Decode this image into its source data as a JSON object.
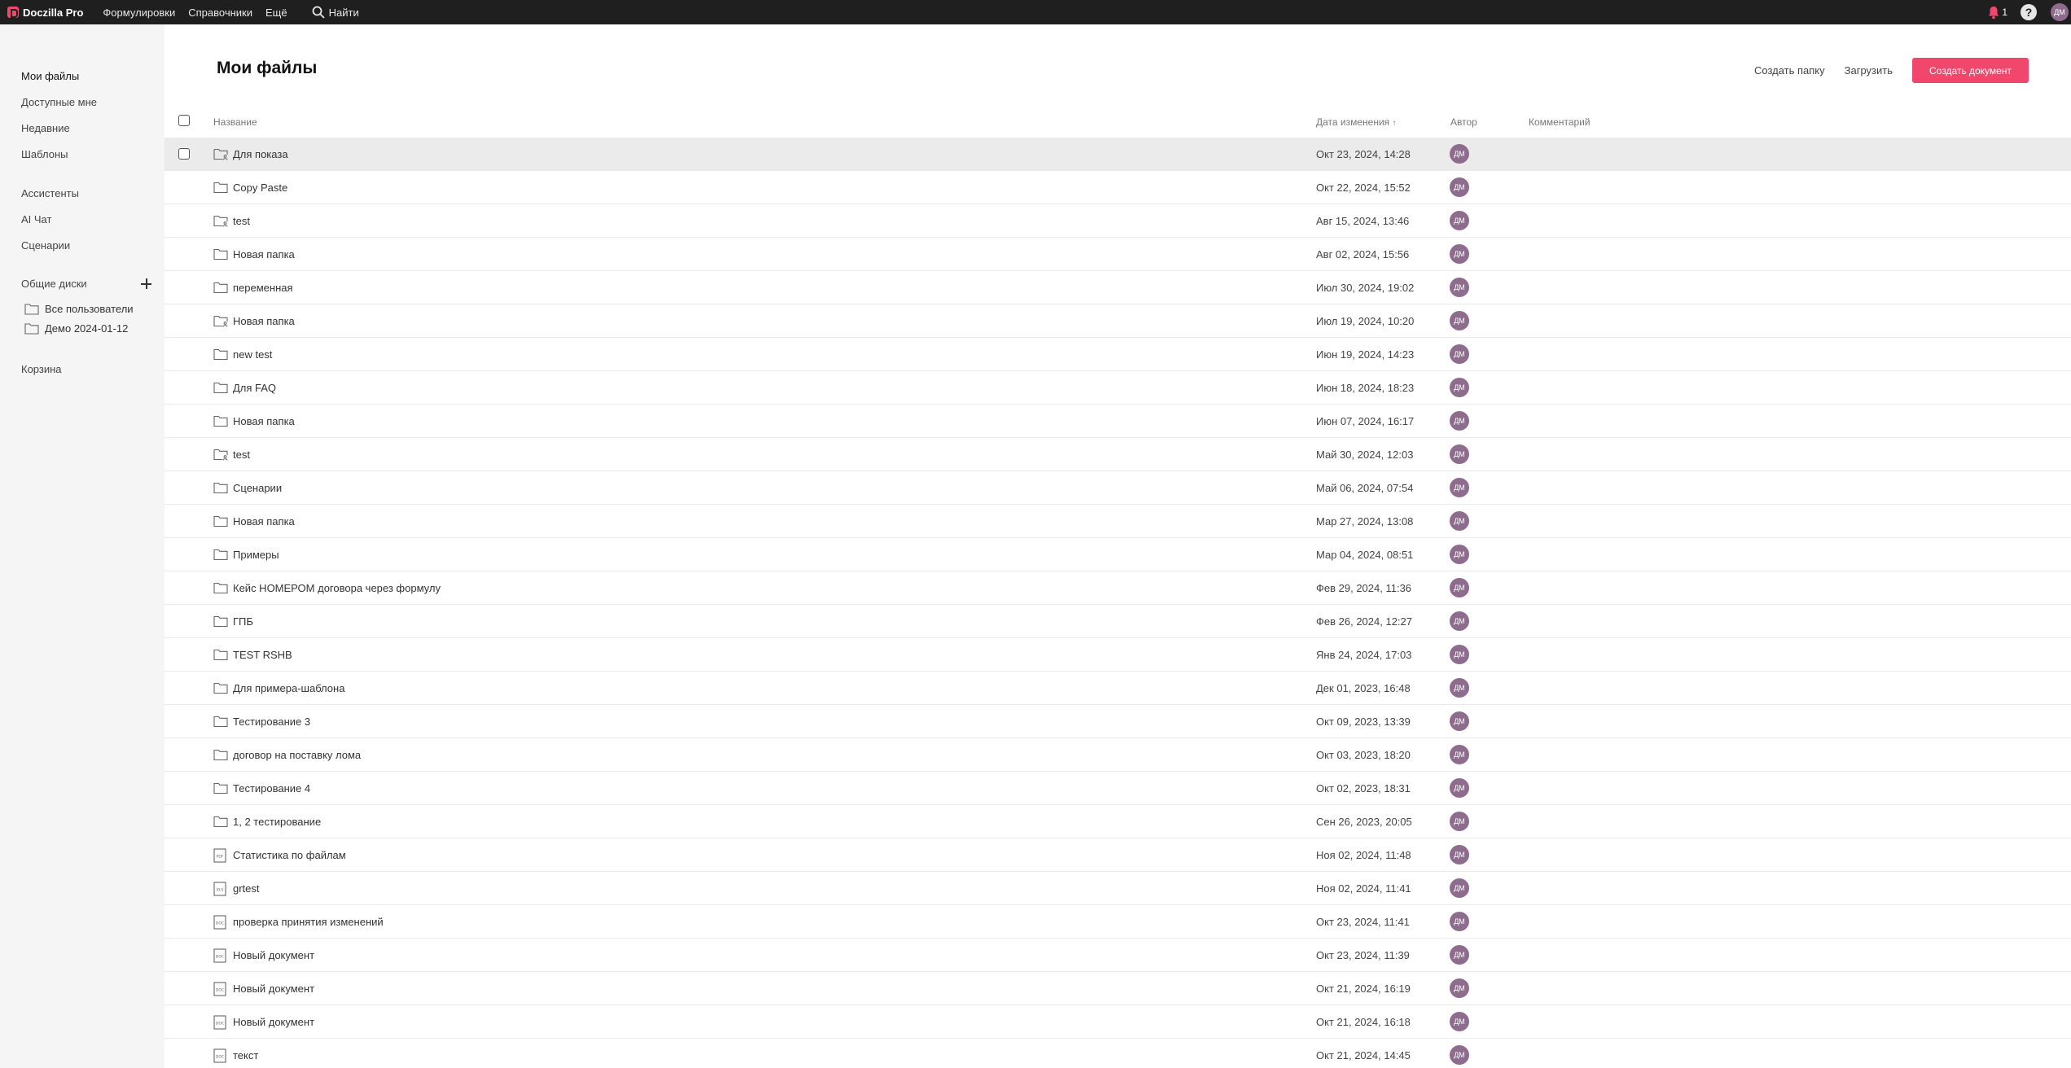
{
  "topbar": {
    "brand": "Doczilla Pro",
    "nav": [
      "Формулировки",
      "Справочники",
      "Ещё"
    ],
    "search_label": "Найти",
    "notifications_count": "1",
    "help_label": "?",
    "user_initials": "ДМ"
  },
  "sidebar": {
    "items": [
      {
        "label": "Мои файлы"
      },
      {
        "label": "Доступные мне"
      },
      {
        "label": "Недавние"
      },
      {
        "label": "Шаблоны"
      },
      {
        "label": "Ассистенты"
      },
      {
        "label": "AI Чат"
      },
      {
        "label": "Сценарии"
      }
    ],
    "shared_header": "Общие диски",
    "shared_disks": [
      {
        "label": "Все пользователи"
      },
      {
        "label": "Демо 2024-01-12"
      }
    ],
    "trash": "Корзина"
  },
  "main": {
    "title": "Мои файлы",
    "create_folder": "Создать папку",
    "upload": "Загрузить",
    "create_document": "Создать документ",
    "columns": {
      "name": "Название",
      "date": "Дата изменения",
      "author": "Автор",
      "comment": "Комментарий"
    },
    "rows": [
      {
        "icon": "shared-folder",
        "name": "Для показа",
        "date": "Окт 23, 2024, 14:28",
        "author": "ДМ"
      },
      {
        "icon": "folder",
        "name": "Copy Paste",
        "date": "Окт 22, 2024, 15:52",
        "author": "ДМ"
      },
      {
        "icon": "shared-folder",
        "name": "test",
        "date": "Авг 15, 2024, 13:46",
        "author": "ДМ"
      },
      {
        "icon": "folder",
        "name": "Новая папка",
        "date": "Авг 02, 2024, 15:56",
        "author": "ДМ"
      },
      {
        "icon": "folder",
        "name": "переменная",
        "date": "Июл 30, 2024, 19:02",
        "author": "ДМ"
      },
      {
        "icon": "shared-folder",
        "name": "Новая папка",
        "date": "Июл 19, 2024, 10:20",
        "author": "ДМ"
      },
      {
        "icon": "folder",
        "name": "new test",
        "date": "Июн 19, 2024, 14:23",
        "author": "ДМ"
      },
      {
        "icon": "folder",
        "name": "Для FAQ",
        "date": "Июн 18, 2024, 18:23",
        "author": "ДМ"
      },
      {
        "icon": "folder",
        "name": "Новая папка",
        "date": "Июн 07, 2024, 16:17",
        "author": "ДМ"
      },
      {
        "icon": "shared-folder",
        "name": "test",
        "date": "Май 30, 2024, 12:03",
        "author": "ДМ"
      },
      {
        "icon": "folder",
        "name": "Сценарии",
        "date": "Май 06, 2024, 07:54",
        "author": "ДМ"
      },
      {
        "icon": "folder",
        "name": "Новая папка",
        "date": "Мар 27, 2024, 13:08",
        "author": "ДМ"
      },
      {
        "icon": "folder",
        "name": "Примеры",
        "date": "Мар 04, 2024, 08:51",
        "author": "ДМ"
      },
      {
        "icon": "folder",
        "name": "Кейс НОМЕРОМ договора через формулу",
        "date": "Фев 29, 2024, 11:36",
        "author": "ДМ"
      },
      {
        "icon": "folder",
        "name": "ГПБ",
        "date": "Фев 26, 2024, 12:27",
        "author": "ДМ"
      },
      {
        "icon": "folder",
        "name": "TEST RSHB",
        "date": "Янв 24, 2024, 17:03",
        "author": "ДМ"
      },
      {
        "icon": "folder",
        "name": "Для примера-шаблона",
        "date": "Дек 01, 2023, 16:48",
        "author": "ДМ"
      },
      {
        "icon": "folder",
        "name": "Тестирование 3",
        "date": "Окт 09, 2023, 13:39",
        "author": "ДМ"
      },
      {
        "icon": "folder",
        "name": "договор на поставку лома",
        "date": "Окт 03, 2023, 18:20",
        "author": "ДМ"
      },
      {
        "icon": "folder",
        "name": "Тестирование 4",
        "date": "Окт 02, 2023, 18:31",
        "author": "ДМ"
      },
      {
        "icon": "folder",
        "name": "1, 2 тестирование",
        "date": "Сен 26, 2023, 20:05",
        "author": "ДМ"
      },
      {
        "icon": "pdf-file",
        "name": "Статистика по файлам",
        "date": "Ноя 02, 2024, 11:48",
        "author": "ДМ"
      },
      {
        "icon": "xlsx-file",
        "name": "grtest",
        "date": "Ноя 02, 2024, 11:41",
        "author": "ДМ"
      },
      {
        "icon": "docx-file",
        "name": "проверка принятия изменений",
        "date": "Окт 23, 2024, 11:41",
        "author": "ДМ"
      },
      {
        "icon": "docx-file",
        "name": "Новый документ",
        "date": "Окт 23, 2024, 11:39",
        "author": "ДМ"
      },
      {
        "icon": "docx-file",
        "name": "Новый документ",
        "date": "Окт 21, 2024, 16:19",
        "author": "ДМ"
      },
      {
        "icon": "docx-file",
        "name": "Новый документ",
        "date": "Окт 21, 2024, 16:18",
        "author": "ДМ"
      },
      {
        "icon": "docx-file",
        "name": "текст",
        "date": "Окт 21, 2024, 14:45",
        "author": "ДМ"
      }
    ]
  },
  "colors": {
    "topbar_bg": "#1f1f1f",
    "accent": "#f2476c",
    "avatar": "#8e6c8e",
    "sidebar_bg": "#f5f5f5",
    "selected_row": "#ebebeb"
  }
}
